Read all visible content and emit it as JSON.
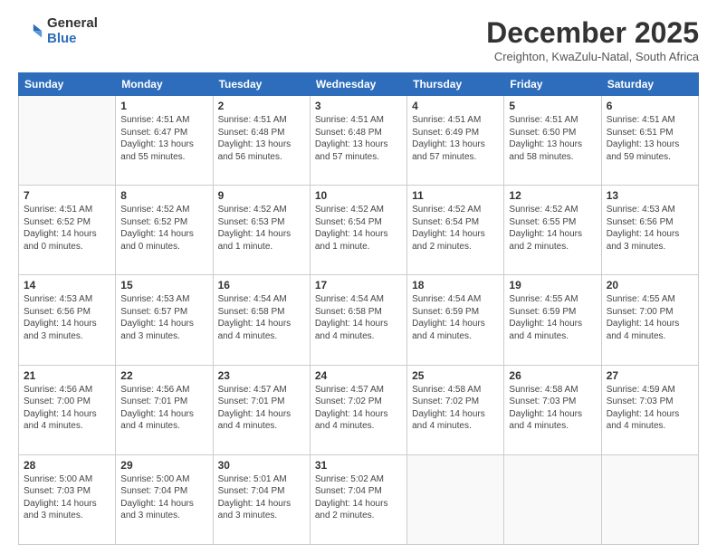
{
  "logo": {
    "general": "General",
    "blue": "Blue"
  },
  "header": {
    "month": "December 2025",
    "location": "Creighton, KwaZulu-Natal, South Africa"
  },
  "days": [
    "Sunday",
    "Monday",
    "Tuesday",
    "Wednesday",
    "Thursday",
    "Friday",
    "Saturday"
  ],
  "weeks": [
    [
      {
        "day": "",
        "info": ""
      },
      {
        "day": "1",
        "info": "Sunrise: 4:51 AM\nSunset: 6:47 PM\nDaylight: 13 hours\nand 55 minutes."
      },
      {
        "day": "2",
        "info": "Sunrise: 4:51 AM\nSunset: 6:48 PM\nDaylight: 13 hours\nand 56 minutes."
      },
      {
        "day": "3",
        "info": "Sunrise: 4:51 AM\nSunset: 6:48 PM\nDaylight: 13 hours\nand 57 minutes."
      },
      {
        "day": "4",
        "info": "Sunrise: 4:51 AM\nSunset: 6:49 PM\nDaylight: 13 hours\nand 57 minutes."
      },
      {
        "day": "5",
        "info": "Sunrise: 4:51 AM\nSunset: 6:50 PM\nDaylight: 13 hours\nand 58 minutes."
      },
      {
        "day": "6",
        "info": "Sunrise: 4:51 AM\nSunset: 6:51 PM\nDaylight: 13 hours\nand 59 minutes."
      }
    ],
    [
      {
        "day": "7",
        "info": "Sunrise: 4:51 AM\nSunset: 6:52 PM\nDaylight: 14 hours\nand 0 minutes."
      },
      {
        "day": "8",
        "info": "Sunrise: 4:52 AM\nSunset: 6:52 PM\nDaylight: 14 hours\nand 0 minutes."
      },
      {
        "day": "9",
        "info": "Sunrise: 4:52 AM\nSunset: 6:53 PM\nDaylight: 14 hours\nand 1 minute."
      },
      {
        "day": "10",
        "info": "Sunrise: 4:52 AM\nSunset: 6:54 PM\nDaylight: 14 hours\nand 1 minute."
      },
      {
        "day": "11",
        "info": "Sunrise: 4:52 AM\nSunset: 6:54 PM\nDaylight: 14 hours\nand 2 minutes."
      },
      {
        "day": "12",
        "info": "Sunrise: 4:52 AM\nSunset: 6:55 PM\nDaylight: 14 hours\nand 2 minutes."
      },
      {
        "day": "13",
        "info": "Sunrise: 4:53 AM\nSunset: 6:56 PM\nDaylight: 14 hours\nand 3 minutes."
      }
    ],
    [
      {
        "day": "14",
        "info": "Sunrise: 4:53 AM\nSunset: 6:56 PM\nDaylight: 14 hours\nand 3 minutes."
      },
      {
        "day": "15",
        "info": "Sunrise: 4:53 AM\nSunset: 6:57 PM\nDaylight: 14 hours\nand 3 minutes."
      },
      {
        "day": "16",
        "info": "Sunrise: 4:54 AM\nSunset: 6:58 PM\nDaylight: 14 hours\nand 4 minutes."
      },
      {
        "day": "17",
        "info": "Sunrise: 4:54 AM\nSunset: 6:58 PM\nDaylight: 14 hours\nand 4 minutes."
      },
      {
        "day": "18",
        "info": "Sunrise: 4:54 AM\nSunset: 6:59 PM\nDaylight: 14 hours\nand 4 minutes."
      },
      {
        "day": "19",
        "info": "Sunrise: 4:55 AM\nSunset: 6:59 PM\nDaylight: 14 hours\nand 4 minutes."
      },
      {
        "day": "20",
        "info": "Sunrise: 4:55 AM\nSunset: 7:00 PM\nDaylight: 14 hours\nand 4 minutes."
      }
    ],
    [
      {
        "day": "21",
        "info": "Sunrise: 4:56 AM\nSunset: 7:00 PM\nDaylight: 14 hours\nand 4 minutes."
      },
      {
        "day": "22",
        "info": "Sunrise: 4:56 AM\nSunset: 7:01 PM\nDaylight: 14 hours\nand 4 minutes."
      },
      {
        "day": "23",
        "info": "Sunrise: 4:57 AM\nSunset: 7:01 PM\nDaylight: 14 hours\nand 4 minutes."
      },
      {
        "day": "24",
        "info": "Sunrise: 4:57 AM\nSunset: 7:02 PM\nDaylight: 14 hours\nand 4 minutes."
      },
      {
        "day": "25",
        "info": "Sunrise: 4:58 AM\nSunset: 7:02 PM\nDaylight: 14 hours\nand 4 minutes."
      },
      {
        "day": "26",
        "info": "Sunrise: 4:58 AM\nSunset: 7:03 PM\nDaylight: 14 hours\nand 4 minutes."
      },
      {
        "day": "27",
        "info": "Sunrise: 4:59 AM\nSunset: 7:03 PM\nDaylight: 14 hours\nand 4 minutes."
      }
    ],
    [
      {
        "day": "28",
        "info": "Sunrise: 5:00 AM\nSunset: 7:03 PM\nDaylight: 14 hours\nand 3 minutes."
      },
      {
        "day": "29",
        "info": "Sunrise: 5:00 AM\nSunset: 7:04 PM\nDaylight: 14 hours\nand 3 minutes."
      },
      {
        "day": "30",
        "info": "Sunrise: 5:01 AM\nSunset: 7:04 PM\nDaylight: 14 hours\nand 3 minutes."
      },
      {
        "day": "31",
        "info": "Sunrise: 5:02 AM\nSunset: 7:04 PM\nDaylight: 14 hours\nand 2 minutes."
      },
      {
        "day": "",
        "info": ""
      },
      {
        "day": "",
        "info": ""
      },
      {
        "day": "",
        "info": ""
      }
    ]
  ]
}
